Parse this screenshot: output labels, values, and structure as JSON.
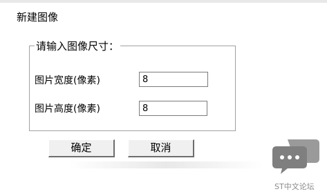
{
  "window": {
    "title": "新建图像"
  },
  "group": {
    "legend": "请输入图像尺寸："
  },
  "fields": {
    "width_label": "图片宽度(像素)",
    "width_value": "8",
    "height_label": "图片高度(像素)",
    "height_value": "8"
  },
  "buttons": {
    "ok_label": "确定",
    "cancel_label": "取消"
  },
  "watermark": {
    "text": "ST中文论坛",
    "icon": "chat-bubble-icon"
  },
  "colors": {
    "watermark_icon": "#8a8a8a",
    "dialog_bg": "#ffffff",
    "button_bg": "#f0f0f0"
  }
}
